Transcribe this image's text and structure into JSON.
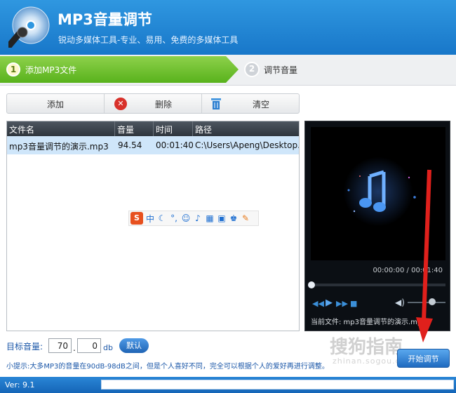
{
  "app": {
    "title": "MP3音量调节",
    "subtitle": "锐动多媒体工具-专业、易用、免费的多媒体工具"
  },
  "steps": [
    {
      "num": "1",
      "label": "添加MP3文件",
      "active": true
    },
    {
      "num": "2",
      "label": "调节音量",
      "active": false
    }
  ],
  "toolbar": {
    "add_label": "添加",
    "delete_label": "删除",
    "clear_label": "清空"
  },
  "table": {
    "headers": [
      "文件名",
      "音量",
      "时间",
      "路径"
    ],
    "rows": [
      {
        "name": "mp3音量调节的演示.mp3",
        "volume": "94.54",
        "time": "00:01:40",
        "path": "C:\\Users\\Apeng\\Desktop..."
      }
    ]
  },
  "ime": {
    "logo": "S",
    "mode": "中",
    "icons": [
      "moon-icon",
      "punctuation-icon",
      "emoji-icon",
      "mic-icon",
      "keyboard-icon",
      "toolbox-icon",
      "skin-icon",
      "wrench-icon"
    ]
  },
  "player": {
    "time": "00:00:00 / 00:01:40",
    "current_file": "当前文件: mp3音量调节的演示.mp3",
    "seek_fraction": 0.0,
    "volume_fraction": 0.7
  },
  "volume_setting": {
    "label": "目标音量:",
    "int_value": "70",
    "dot": ".",
    "dec_value": "0",
    "unit": "db",
    "default_label": "默认",
    "tip": "小提示:大多MP3的音量在90dB-98dB之间，但是个人喜好不同，完全可以根据个人的爱好再进行调整。"
  },
  "start_button": "开始调节",
  "watermark": {
    "text": "搜狗指南",
    "url": "zhinan.sogou.com"
  },
  "status": {
    "version": "Ver: 9.1"
  },
  "colors": {
    "header": "#1f80d0",
    "step_active": "#6cc22c",
    "accent_arrow": "#e0201c"
  }
}
